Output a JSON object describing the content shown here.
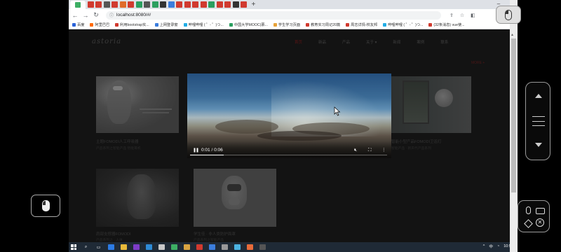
{
  "browser": {
    "url": "localhost:8080/#/",
    "bookmarks": [
      {
        "label": "百度",
        "color": "#2a62d8"
      },
      {
        "label": "阿里巴巴",
        "color": "#ff6a00"
      },
      {
        "label": "利用bootstrap实...",
        "color": "#d13a2f"
      },
      {
        "label": "上网登录窗",
        "color": "#3b7ddd"
      },
      {
        "label": "哔哩哔哩 ( ゜- ゜)つ...",
        "color": "#23ade5"
      },
      {
        "label": "中国大学MOOC(慕...",
        "color": "#2b9f5f"
      },
      {
        "label": "学生学习页面",
        "color": "#e8a33a"
      },
      {
        "label": "教育实习周记20篇",
        "color": "#d13a2f"
      },
      {
        "label": "周志详情-校友邦",
        "color": "#d13a2f"
      },
      {
        "label": "哔哩哔哩 ( ゜- ゜)つ...",
        "color": "#23ade5"
      },
      {
        "label": "(32条消息) vue使...",
        "color": "#d13a2f"
      }
    ]
  },
  "site": {
    "logo": "astoria",
    "nav": [
      "首页",
      "新品",
      "产品",
      "关于 ▾",
      "新闻",
      "案例",
      "联系"
    ],
    "active_nav_index": 0,
    "more": "MORE +",
    "cards": [
      {
        "title": "主题FOMODI人工呼吸器",
        "subtitle": "产品系列之智能产品 智能耳机"
      },
      {
        "title": "智能小型产品FOMODI卫浴灯",
        "subtitle": "智能产品 · 新声代产品系列"
      },
      {
        "title": "肩部支撑器FOMODI",
        "subtitle": "产品系列之 · 人体"
      },
      {
        "title": "学生佳 · 非人类防护面罩",
        "subtitle": "产品系列之智能产品"
      }
    ]
  },
  "video": {
    "time": "0:01 / 0:06",
    "progress": 0.17
  },
  "taskbar": {
    "lang": "中",
    "time": "10:52"
  }
}
